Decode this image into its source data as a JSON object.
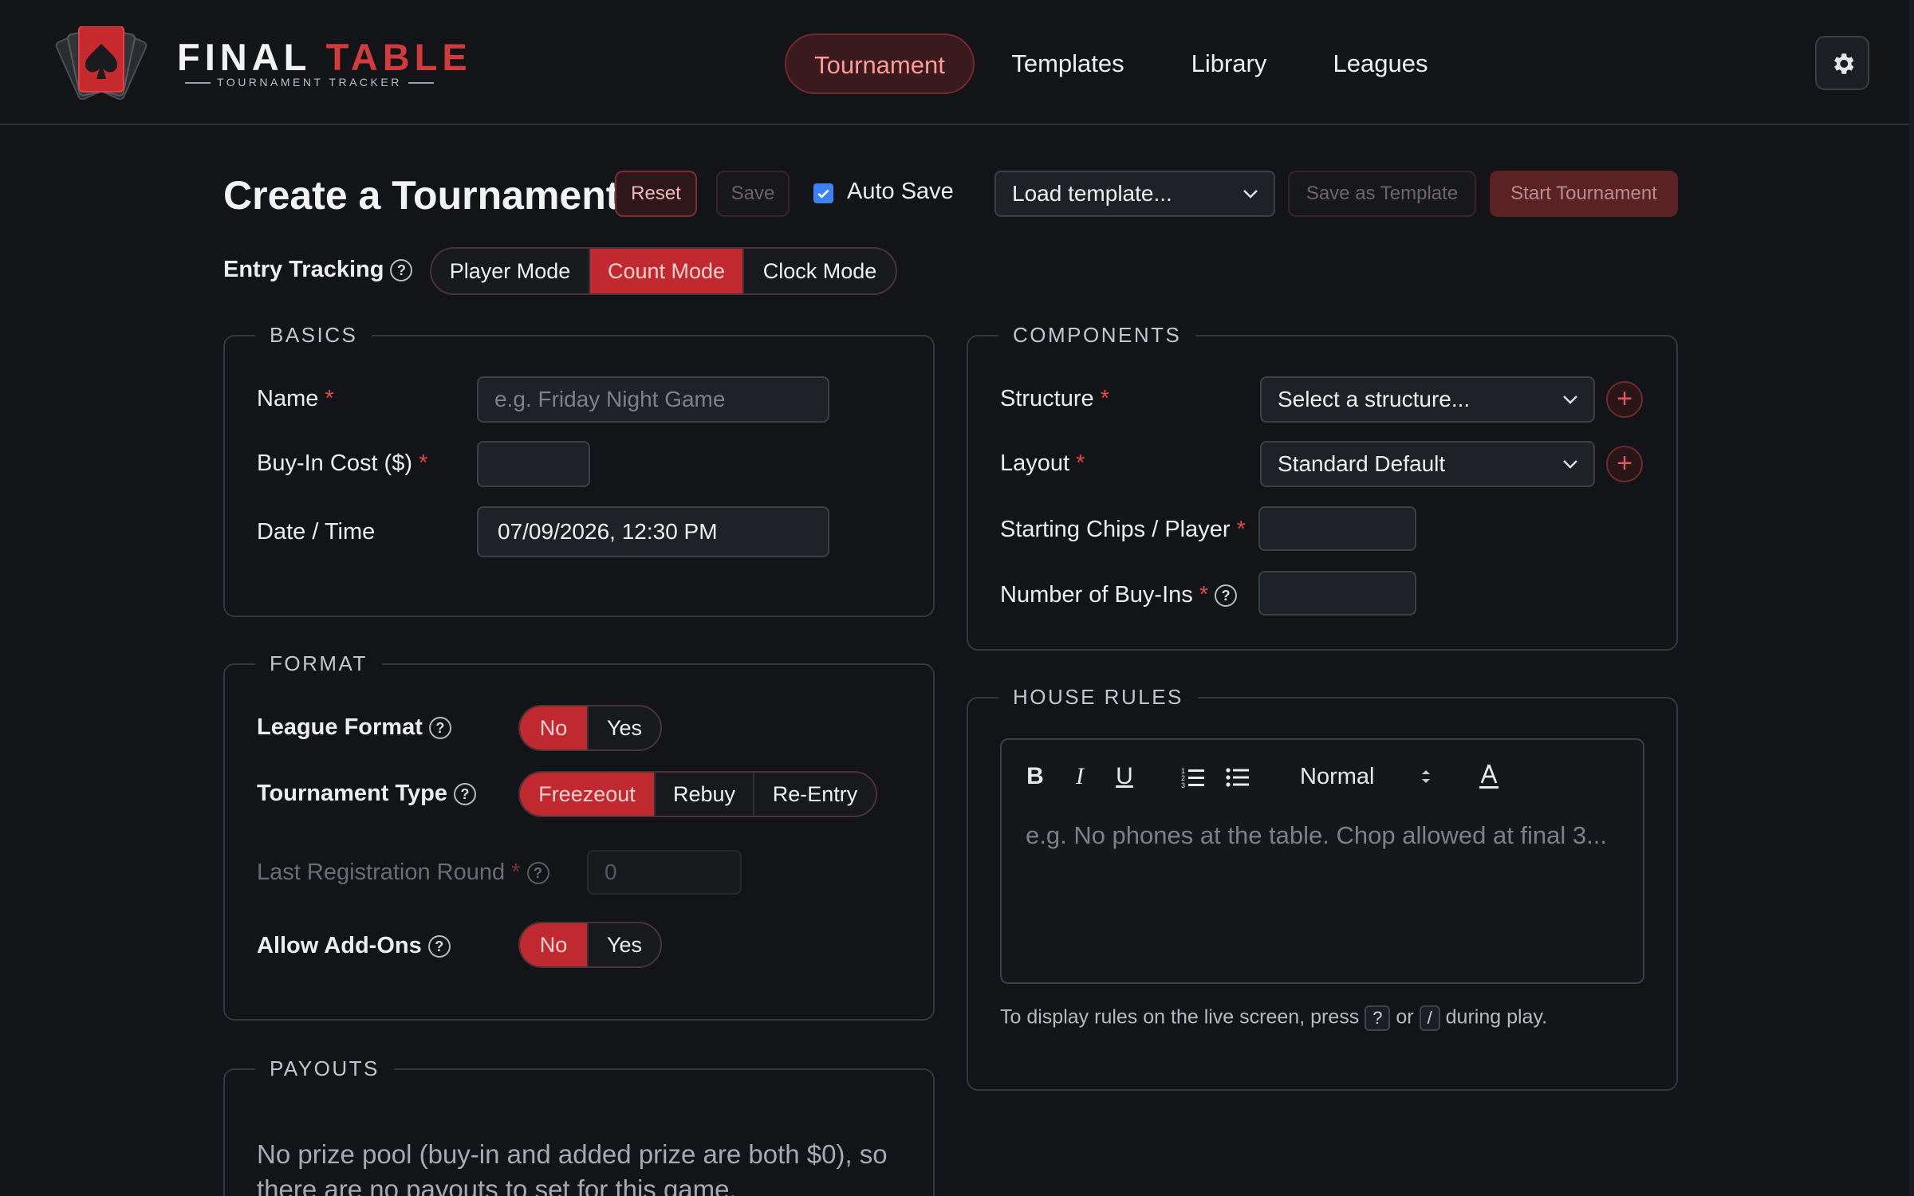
{
  "header": {
    "brand_left": "FINAL",
    "brand_right": "TABLE",
    "brand_sub": "TOURNAMENT TRACKER",
    "nav": [
      {
        "label": "Tournament",
        "active": true
      },
      {
        "label": "Templates",
        "active": false
      },
      {
        "label": "Library",
        "active": false
      },
      {
        "label": "Leagues",
        "active": false
      }
    ],
    "settings_icon": "gear-icon"
  },
  "toolbar": {
    "title": "Create a Tournament",
    "reset_label": "Reset",
    "save_label": "Save",
    "autosave_label": "Auto Save",
    "autosave_checked": true,
    "template_select": "Load template...",
    "save_template_label": "Save as Template",
    "start_label": "Start Tournament"
  },
  "entry_tracking": {
    "label": "Entry Tracking",
    "options": [
      "Player Mode",
      "Count Mode",
      "Clock Mode"
    ],
    "selected": "Count Mode"
  },
  "basics": {
    "legend": "BASICS",
    "name_label": "Name",
    "name_placeholder": "e.g. Friday Night Game",
    "buyin_label": "Buy-In Cost ($)",
    "buyin_value": "",
    "datetime_label": "Date / Time",
    "datetime_value": "07/09/2026, 12:30 PM"
  },
  "components": {
    "legend": "COMPONENTS",
    "structure_label": "Structure",
    "structure_value": "Select a structure...",
    "layout_label": "Layout",
    "layout_value": "Standard Default",
    "chips_label": "Starting Chips / Player",
    "buyins_label": "Number of Buy-Ins"
  },
  "format": {
    "legend": "FORMAT",
    "league_label": "League Format",
    "league_options": [
      "No",
      "Yes"
    ],
    "league_selected": "No",
    "type_label": "Tournament Type",
    "type_options": [
      "Freezeout",
      "Rebuy",
      "Re-Entry"
    ],
    "type_selected": "Freezeout",
    "last_reg_label": "Last Registration Round",
    "last_reg_placeholder": "0",
    "addons_label": "Allow Add-Ons",
    "addons_options": [
      "No",
      "Yes"
    ],
    "addons_selected": "No"
  },
  "house_rules": {
    "legend": "HOUSE RULES",
    "text_style": "Normal",
    "placeholder": "e.g. No phones at the table. Chop allowed at final 3...",
    "hint_before": "To display rules on the live screen, press",
    "key1": "?",
    "hint_or": "or",
    "key2": "/",
    "hint_after": "during play."
  },
  "payouts": {
    "legend": "PAYOUTS",
    "line1": "No prize pool (buy-in and added prize are both $0), so",
    "line2": "there are no payouts to set for this game."
  },
  "colors": {
    "accent": "#c0292f",
    "background": "#121417",
    "brand_red": "#d13b3b"
  }
}
